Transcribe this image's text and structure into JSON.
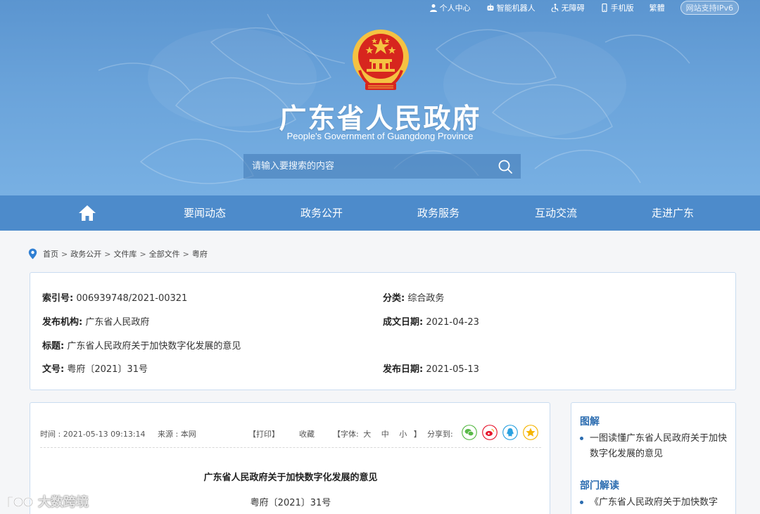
{
  "topbar": {
    "items": [
      {
        "label": "个人中心",
        "icon": "user-icon"
      },
      {
        "label": "智能机器人",
        "icon": "robot-icon"
      },
      {
        "label": "无障碍",
        "icon": "accessibility-icon"
      },
      {
        "label": "手机版",
        "icon": "mobile-icon"
      },
      {
        "label": "繁體"
      }
    ],
    "ipv6_label": "网站支持IPv6"
  },
  "header": {
    "title": "广东省人民政府",
    "subtitle": "People's Government of Guangdong Province",
    "emblem_icon": "national-emblem-icon"
  },
  "search": {
    "placeholder": "请输入要搜索的内容",
    "icon": "search-icon"
  },
  "nav": {
    "home_icon": "home-icon",
    "items": [
      "要闻动态",
      "政务公开",
      "政务服务",
      "互动交流",
      "走进广东"
    ]
  },
  "breadcrumb": {
    "icon": "location-pin-icon",
    "items": [
      "首页",
      "政务公开",
      "文件库",
      "全部文件",
      "粤府"
    ]
  },
  "info": {
    "index_key": "索引号:",
    "index_val": "006939748/2021-00321",
    "category_key": "分类:",
    "category_val": "综合政务",
    "issuer_key": "发布机构:",
    "issuer_val": "广东省人民政府",
    "written_key": "成文日期:",
    "written_val": "2021-04-23",
    "title_key": "标题:",
    "title_val": "广东省人民政府关于加快数字化发展的意见",
    "docno_key": "文号:",
    "docno_val": "粤府〔2021〕31号",
    "published_key": "发布日期:",
    "published_val": "2021-05-13"
  },
  "article": {
    "time": "时间 : 2021-05-13 09:13:14",
    "source": "来源 : 本网",
    "print": "【打印】",
    "favorite": "收藏",
    "font_label": "【字体:",
    "font_large": "大",
    "font_medium": "中",
    "font_small": "小",
    "font_close": "】",
    "share_label": "分享到:",
    "share_icons": [
      "wechat-icon",
      "weibo-icon",
      "qq-icon",
      "qzone-icon"
    ],
    "title": "广东省人民政府关于加快数字化发展的意见",
    "doc_no": "粤府〔2021〕31号"
  },
  "side": {
    "section1_title": "图解",
    "section1_item": "一图读懂广东省人民政府关于加快数字化发展的意见",
    "section2_title": "部门解读",
    "section2_item": "《广东省人民政府关于加快数字"
  },
  "watermark": {
    "text": "大数跨境"
  },
  "colors": {
    "header_blue": "#5b95d0",
    "nav_blue": "#4d8bcb",
    "accent_blue": "#2b6cb0",
    "emblem_red": "#d7261e",
    "emblem_gold": "#f5c242"
  }
}
